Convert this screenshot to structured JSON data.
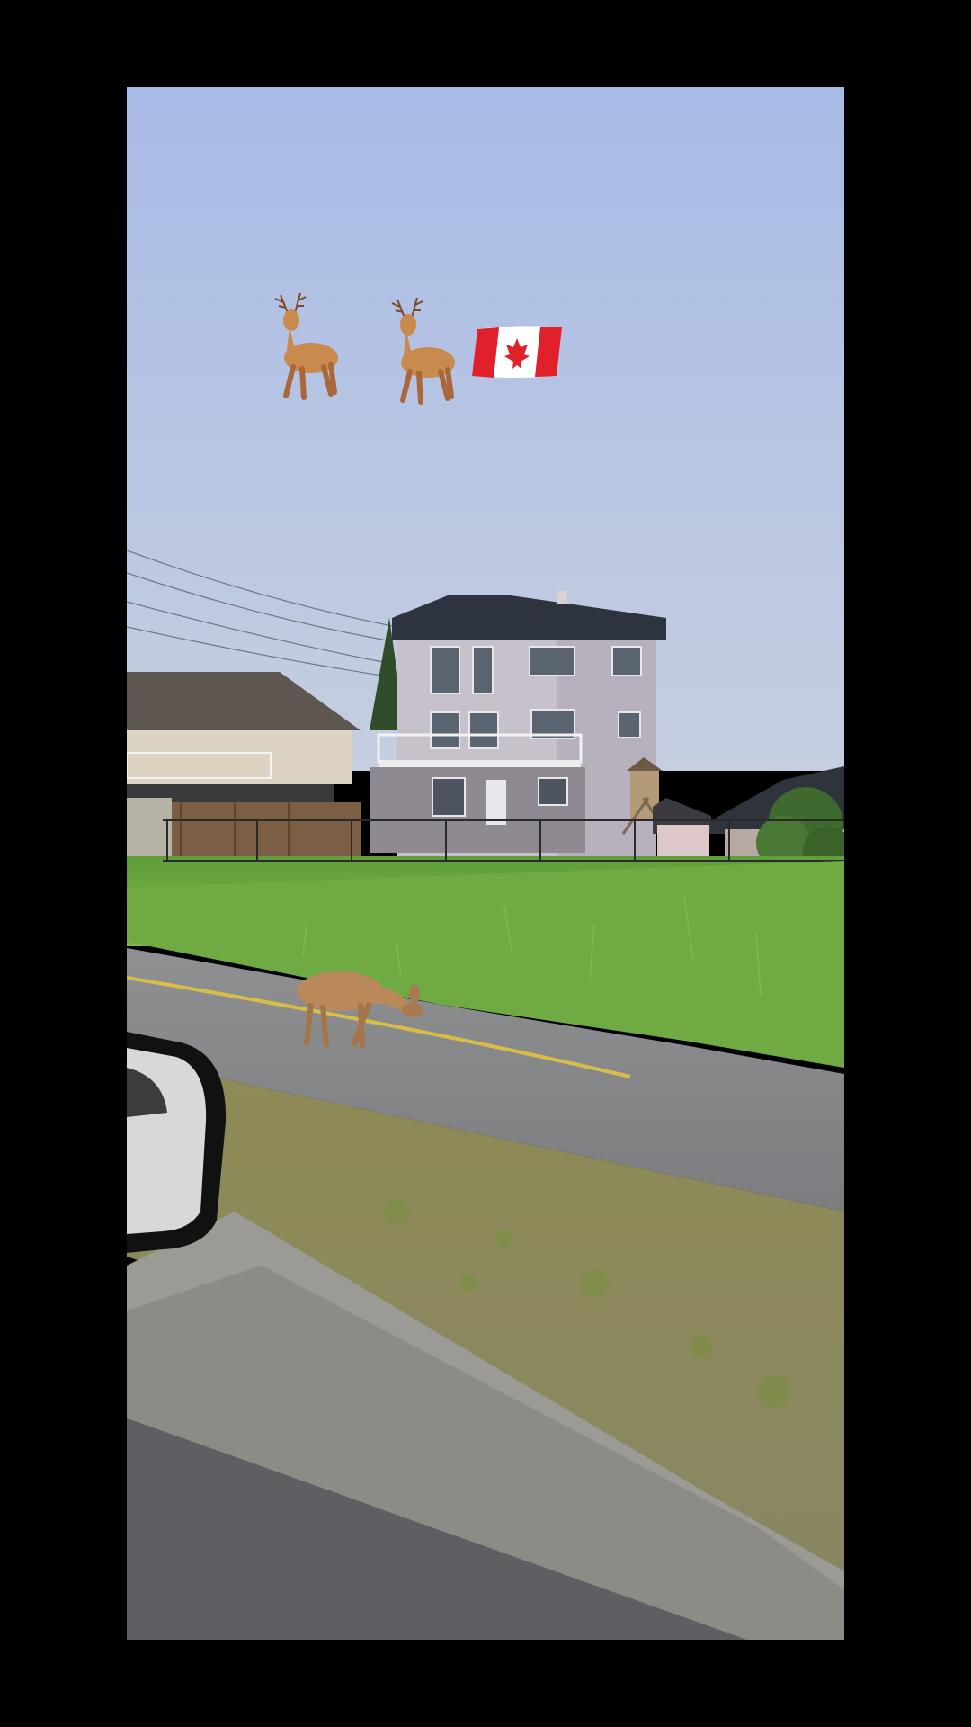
{
  "story": {
    "stickers": [
      {
        "icon": "deer-emoji",
        "glyph": "🦌"
      },
      {
        "icon": "deer-emoji",
        "glyph": "🦌"
      },
      {
        "icon": "canada-flag-emoji",
        "glyph": "🇨🇦"
      }
    ]
  },
  "colors": {
    "background": "#000000",
    "sky_top": "#aabde6",
    "sky_bottom": "#c3cde1",
    "grass": "#79b347",
    "road": "#8b8b8b",
    "road_line": "#d9bd49",
    "deer": "#b9895a",
    "flag_red": "#e0202a"
  }
}
